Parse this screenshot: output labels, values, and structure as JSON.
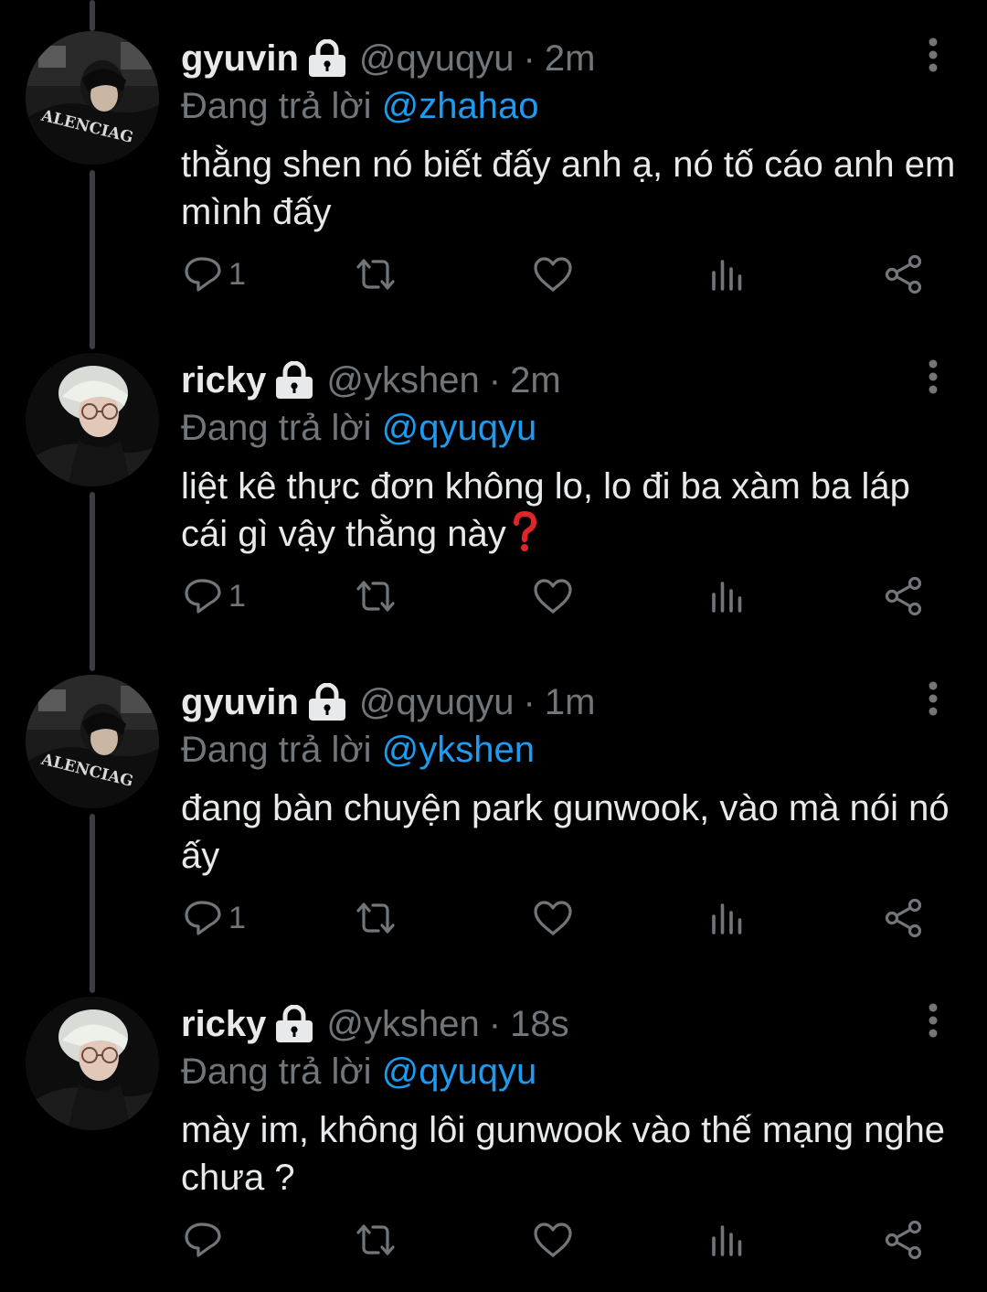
{
  "theme": {
    "background": "#000000",
    "text_primary": "#e7e9ea",
    "text_secondary": "#71767b",
    "accent": "#1d9bf0",
    "thread_line": "#3a3d41"
  },
  "tweets": [
    {
      "display_name": "gyuvin",
      "handle": "@qyuqyu",
      "separator": "·",
      "time": "2m",
      "reply_prefix": "Đang trả lời",
      "reply_to": "@zhahao",
      "text": "thằng shen nó biết đấy anh ạ, nó tố cáo anh em mình đấy",
      "reply_count": "1",
      "avatar": "gyuvin-avatar",
      "avatar_text": "ALENCIAG",
      "verified_lock": "lock-icon"
    },
    {
      "display_name": "ricky",
      "handle": "@ykshen",
      "separator": "·",
      "time": "2m",
      "reply_prefix": "Đang trả lời",
      "reply_to": "@qyuqyu",
      "text": "liệt kê thực đơn không lo, lo đi ba xàm ba láp cái gì vậy thằng này",
      "reply_count": "1",
      "avatar": "ricky-avatar",
      "verified_lock": "lock-icon",
      "trailing_emoji": "red-question-mark-emoji"
    },
    {
      "display_name": "gyuvin",
      "handle": "@qyuqyu",
      "separator": "·",
      "time": "1m",
      "reply_prefix": "Đang trả lời",
      "reply_to": "@ykshen",
      "text": "đang bàn chuyện park gunwook, vào mà nói nó ấy",
      "reply_count": "1",
      "avatar": "gyuvin-avatar",
      "avatar_text": "ALENCIAG",
      "verified_lock": "lock-icon"
    },
    {
      "display_name": "ricky",
      "handle": "@ykshen",
      "separator": "·",
      "time": "18s",
      "reply_prefix": "Đang trả lời",
      "reply_to": "@qyuqyu",
      "text": "mày im, không lôi gunwook vào thế mạng nghe chưa ?",
      "reply_count": "",
      "avatar": "ricky-avatar",
      "verified_lock": "lock-icon"
    }
  ],
  "action_icons": [
    "reply-icon",
    "retweet-icon",
    "like-icon",
    "views-icon",
    "share-icon"
  ],
  "more_icon": "more-vertical-icon"
}
